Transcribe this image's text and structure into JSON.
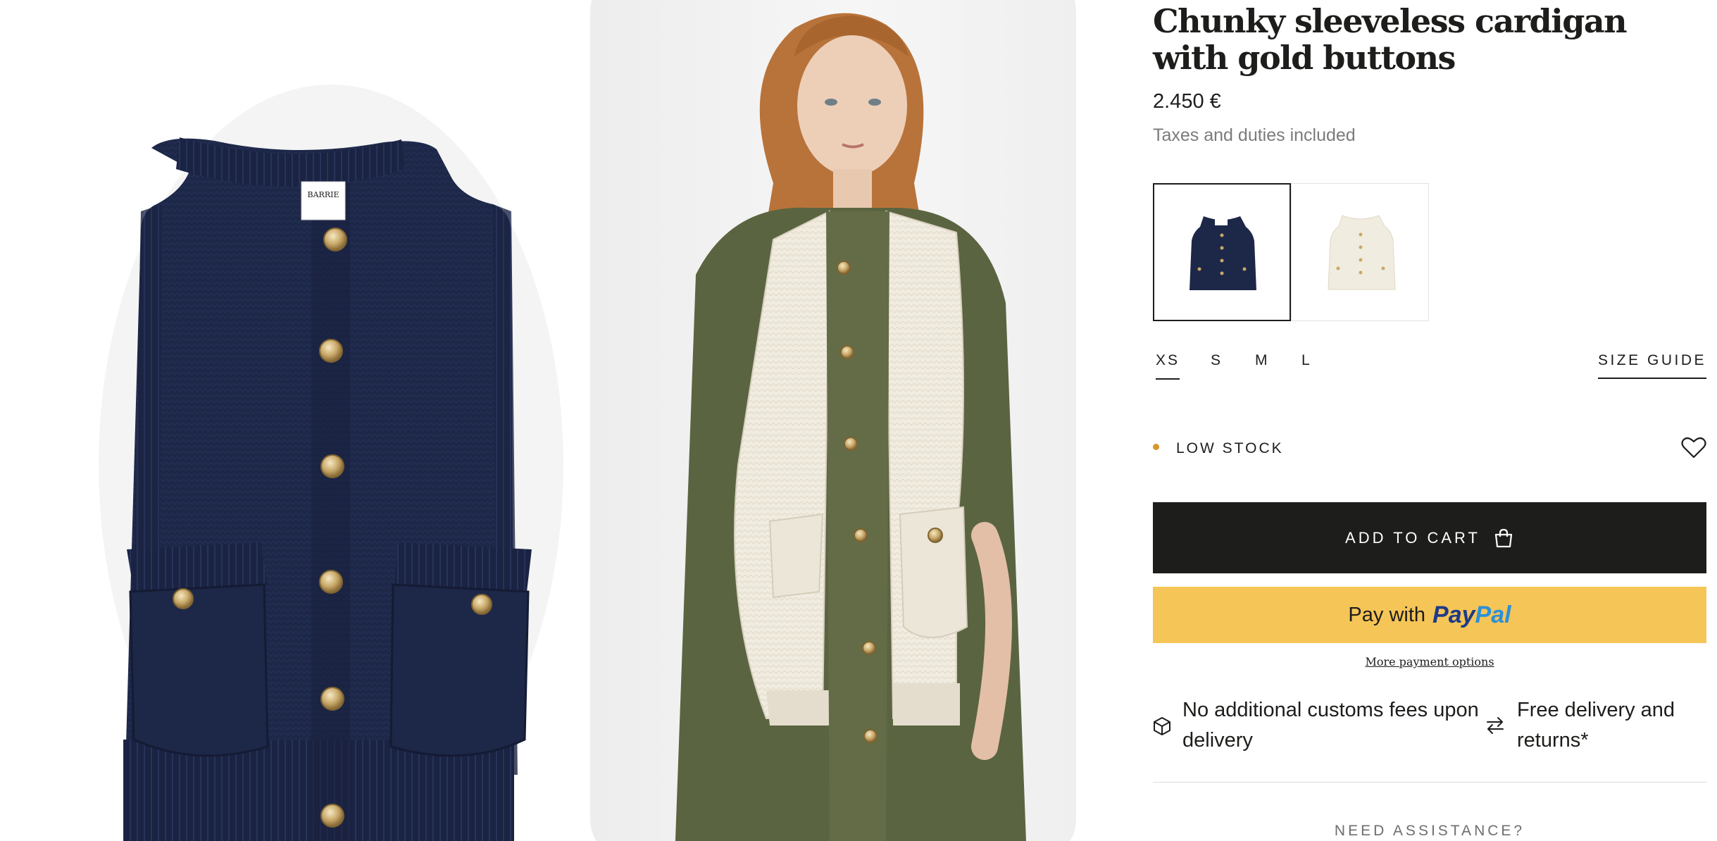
{
  "gallery": {
    "image_1_label": "BARRIE"
  },
  "product": {
    "title": "Chunky sleeveless cardigan with gold buttons",
    "price": "2.450 €",
    "tax_note": "Taxes and duties included"
  },
  "colors": {
    "navy": "#1d2748",
    "cream": "#f1ece0",
    "accent_gold": "#d9962b",
    "paypal_yellow": "#f5c557",
    "cart_black": "#1d1d1b"
  },
  "swatches": [
    {
      "name": "navy",
      "selected": true
    },
    {
      "name": "cream",
      "selected": false
    }
  ],
  "sizes": [
    {
      "label": "XS",
      "selected": true
    },
    {
      "label": "S",
      "selected": false
    },
    {
      "label": "M",
      "selected": false
    },
    {
      "label": "L",
      "selected": false
    }
  ],
  "size_guide_label": "SIZE GUIDE",
  "stock_label": "LOW STOCK",
  "wishlist_icon": "heart-icon",
  "cart": {
    "label": "ADD TO CART",
    "icon": "shopping-bag-icon"
  },
  "paypal": {
    "prefix": "Pay with",
    "brand_a": "Pay",
    "brand_b": "Pal"
  },
  "more_payment": "More payment options",
  "info": {
    "customs_line1": "No additional customs fees upon",
    "customs_line2": "delivery",
    "customs_icon": "package-icon",
    "delivery_line1": "Free delivery and",
    "delivery_line2": "returns*",
    "delivery_icon": "exchange-arrows-icon"
  },
  "assistance": "NEED ASSISTANCE?"
}
